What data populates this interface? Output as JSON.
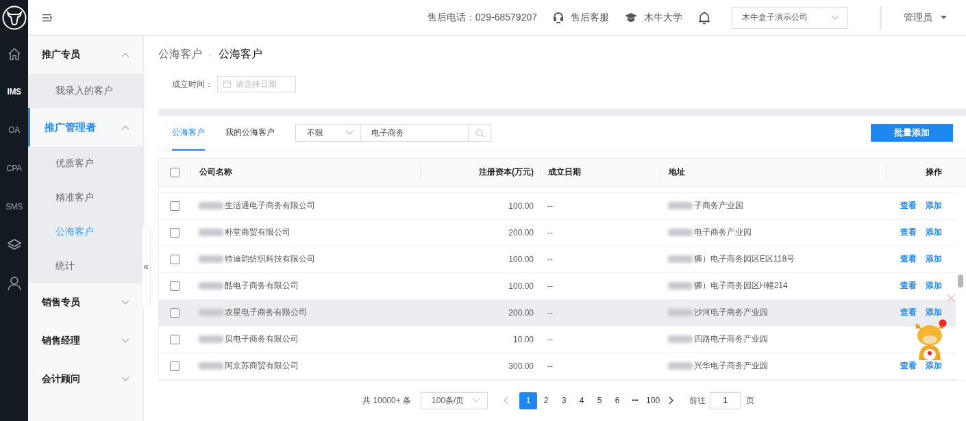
{
  "rail": [
    {
      "kind": "logo"
    },
    {
      "kind": "home"
    },
    {
      "kind": "text",
      "label": "IMS",
      "selected": true
    },
    {
      "kind": "text",
      "label": "OA",
      "selected": false
    },
    {
      "kind": "text",
      "label": "CPA",
      "selected": false
    },
    {
      "kind": "text",
      "label": "SMS",
      "selected": false
    },
    {
      "kind": "layers"
    },
    {
      "kind": "user"
    }
  ],
  "header": {
    "phone": "售后电话：029-68579207",
    "service": "售后客服",
    "university": "木牛大学",
    "company_select": "木牛盒子演示公司",
    "user": "管理员"
  },
  "sidebar": [
    {
      "label": "推广专员",
      "expanded": true,
      "selected": false,
      "children": [
        {
          "label": "我录入的客户",
          "selected": false
        }
      ]
    },
    {
      "label": "推广管理者",
      "expanded": true,
      "selected": true,
      "children": [
        {
          "label": "优质客户",
          "selected": false
        },
        {
          "label": "精准客户",
          "selected": false
        },
        {
          "label": "公海客户",
          "selected": true
        },
        {
          "label": "统计",
          "selected": false
        }
      ]
    },
    {
      "label": "销售专员",
      "expanded": false,
      "selected": false
    },
    {
      "label": "销售经理",
      "expanded": false,
      "selected": false
    },
    {
      "label": "会计顾问",
      "expanded": false,
      "selected": false
    }
  ],
  "collapse_glyph": "«",
  "breadcrumb": [
    "公海客户",
    "-",
    "公海客户"
  ],
  "filter": {
    "label": "成立时间：",
    "placeholder": "请选择日期"
  },
  "tabs": [
    {
      "label": "公海客户",
      "selected": true
    },
    {
      "label": "我的公海客户",
      "selected": false
    }
  ],
  "type_select": "不限",
  "search": {
    "value": "电子商务"
  },
  "add_button": "批量添加",
  "table": {
    "select_all_checked": false,
    "columns": [
      "公司名称",
      "注册资本(万元)",
      "成立日期",
      "地址",
      "操作"
    ],
    "rows": [
      {
        "name": "生活通电子商务有限公司",
        "capital": "100.00",
        "date": "--",
        "address": "子商务产业园",
        "actions": [
          "查看",
          "添加"
        ],
        "checked": false,
        "highlighted": false
      },
      {
        "name": "朴堂商贸有限公司",
        "capital": "200.00",
        "date": "--",
        "address": "电子商务产业园",
        "actions": [
          "查看",
          "添加"
        ],
        "checked": false,
        "highlighted": false
      },
      {
        "name": "特迪韵纺织科技有限公司",
        "capital": "100.00",
        "date": "--",
        "address": "狮）电子商务园区E区118号",
        "actions": [
          "查看",
          "添加"
        ],
        "checked": false,
        "highlighted": false
      },
      {
        "name": "酷电子商务有限公司",
        "capital": "100.00",
        "date": "--",
        "address": "狮）电子商务园区H幢214",
        "actions": [
          "查看",
          "添加"
        ],
        "checked": false,
        "highlighted": false
      },
      {
        "name": "农星电子商务有限公司",
        "capital": "200.00",
        "date": "--",
        "address": "沙河电子商务产业园",
        "actions": [
          "查看",
          "添加"
        ],
        "checked": false,
        "highlighted": true
      },
      {
        "name": "贝电子商务有限公司",
        "capital": "10.00",
        "date": "--",
        "address": "四路电子商务产业园",
        "checked": false,
        "highlighted": false
      },
      {
        "name": "阿京苏商贸有限公司",
        "capital": "300.00",
        "date": "--",
        "address": "兴华电子商务产业园",
        "actions": [
          "查看",
          "添加"
        ],
        "checked": false,
        "highlighted": false
      }
    ]
  },
  "pagination": {
    "total": "共 10000+ 条",
    "page_size": "100条/页",
    "pages": [
      {
        "kind": "page",
        "label": "1",
        "selected": true
      },
      {
        "kind": "page",
        "label": "2",
        "selected": false
      },
      {
        "kind": "page",
        "label": "3",
        "selected": false
      },
      {
        "kind": "page",
        "label": "4",
        "selected": false
      },
      {
        "kind": "page",
        "label": "5",
        "selected": false
      },
      {
        "kind": "page",
        "label": "6",
        "selected": false
      },
      {
        "kind": "more",
        "label": "•••",
        "selected": false
      },
      {
        "kind": "page",
        "label": "100",
        "selected": false
      }
    ],
    "goto_label": "前往",
    "goto_value": "1",
    "goto_suffix": "页"
  }
}
